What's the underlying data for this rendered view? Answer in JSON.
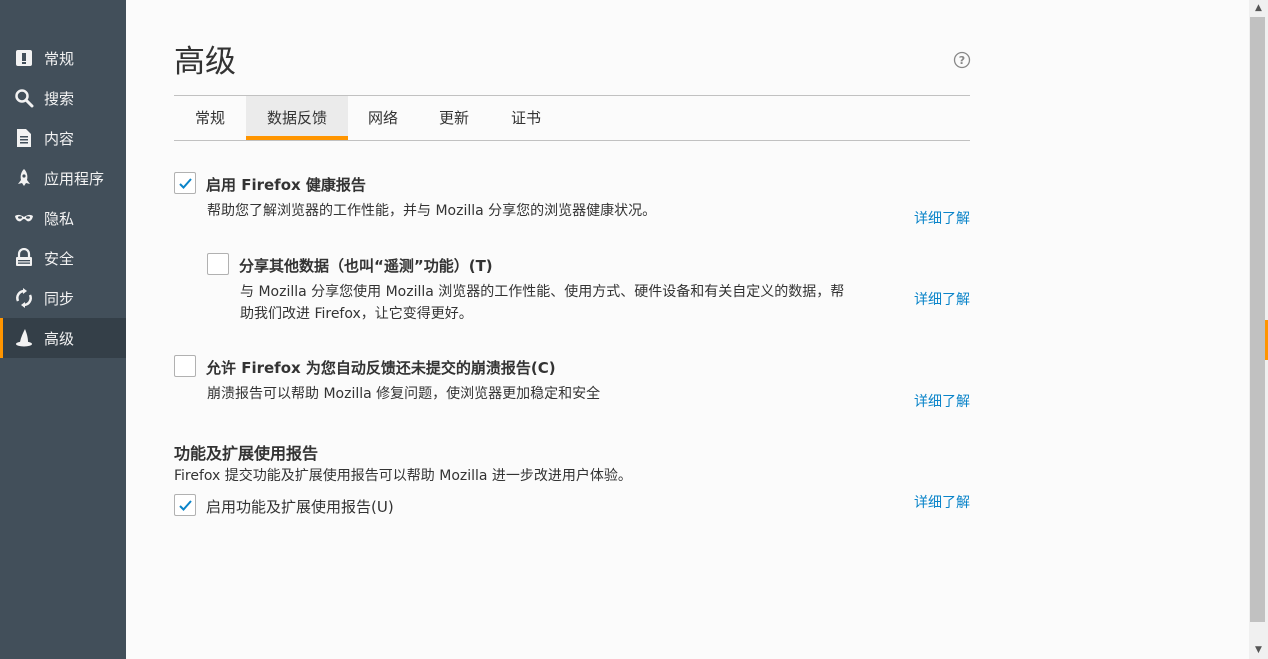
{
  "sidebar": {
    "items": [
      {
        "label": "常规",
        "icon": "general-icon"
      },
      {
        "label": "搜索",
        "icon": "search-icon"
      },
      {
        "label": "内容",
        "icon": "content-icon"
      },
      {
        "label": "应用程序",
        "icon": "applications-icon"
      },
      {
        "label": "隐私",
        "icon": "privacy-mask-icon"
      },
      {
        "label": "安全",
        "icon": "security-lock-icon"
      },
      {
        "label": "同步",
        "icon": "sync-icon"
      },
      {
        "label": "高级",
        "icon": "advanced-wizard-hat-icon"
      }
    ],
    "active_index": 7
  },
  "main": {
    "title": "高级",
    "tabs": [
      "常规",
      "数据反馈",
      "网络",
      "更新",
      "证书"
    ],
    "selected_tab": 1,
    "health_report": {
      "checked": true,
      "label": "启用 Firefox 健康报告",
      "description": "帮助您了解浏览器的工作性能，并与 Mozilla 分享您的浏览器健康状况。",
      "link": "详细了解"
    },
    "share_data": {
      "checked": false,
      "label": "分享其他数据（也叫“遥测”功能）(T)",
      "description_line1": "与 Mozilla 分享您使用 Mozilla 浏览器的工作性能、使用方式、硬件设备和有关自定义的数据，帮",
      "description_line2": "助我们改进 Firefox，让它变得更好。",
      "link": "详细了解"
    },
    "crash_report": {
      "checked": false,
      "label": "允许 Firefox 为您自动反馈还未提交的崩溃报告(C)",
      "description": "崩溃报告可以帮助 Mozilla 修复问题，使浏览器更加稳定和安全",
      "link": "详细了解"
    },
    "feature_report": {
      "section_title": "功能及扩展使用报告",
      "description": "Firefox 提交功能及扩展使用报告可以帮助 Mozilla 进一步改进用户体验。",
      "checked": true,
      "label": "启用功能及扩展使用报告(U)",
      "link": "详细了解"
    }
  },
  "colors": {
    "sidebar_bg": "#424f5a",
    "accent": "#ff9500",
    "link": "#0a84c9",
    "checkmark": "#0a84c9"
  }
}
